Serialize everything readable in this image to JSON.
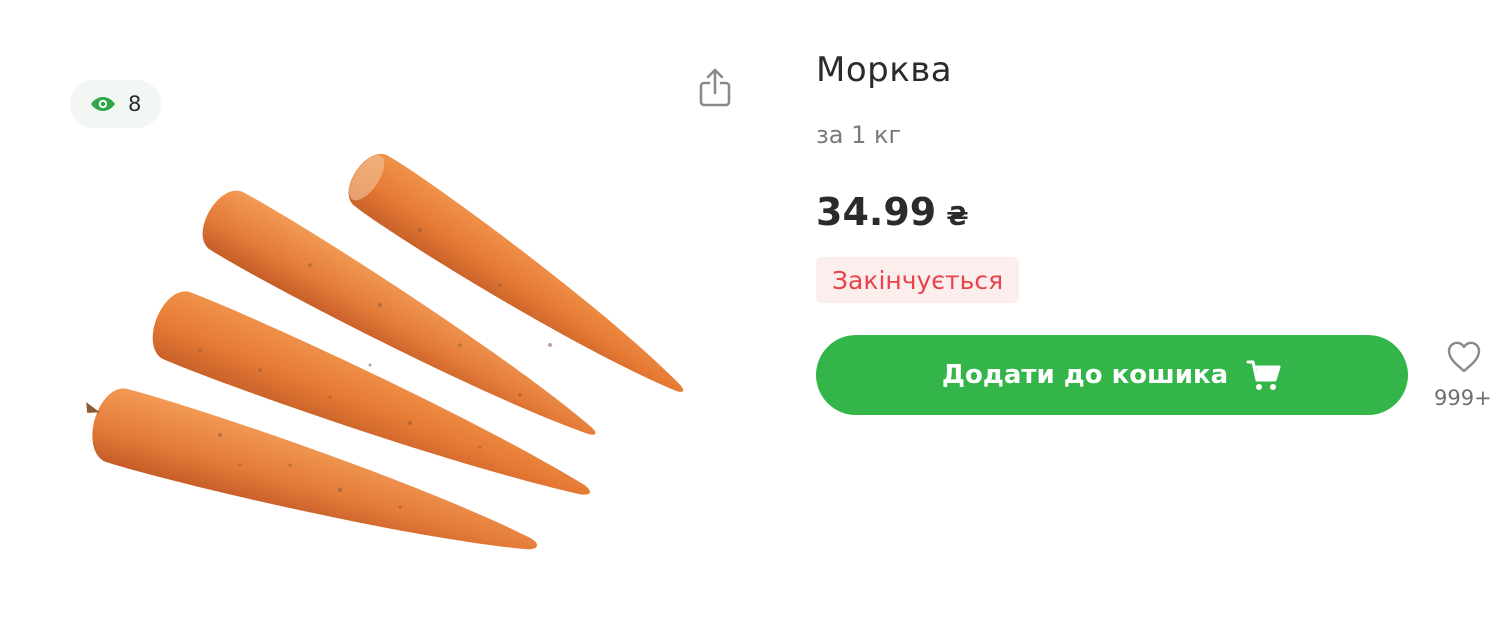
{
  "gallery": {
    "views_count": "8",
    "share_icon": "share-icon",
    "view_icon": "eye-icon",
    "photo": "carrots-product-photo"
  },
  "product": {
    "title": "Морква",
    "unit": "за 1 кг",
    "price": "34.99",
    "currency": "₴",
    "stock_status": "Закінчується",
    "add_to_cart_label": "Додати до кошика",
    "cart_icon": "cart-icon",
    "wishlist_icon": "heart-icon",
    "wishlist_count": "999+"
  },
  "colors": {
    "accent_green": "#34b54a",
    "stock_red": "#e8424a",
    "stock_badge_bg": "#fdeeee",
    "views_badge_bg": "#f3f7f3",
    "eye_green": "#2fa84a"
  }
}
